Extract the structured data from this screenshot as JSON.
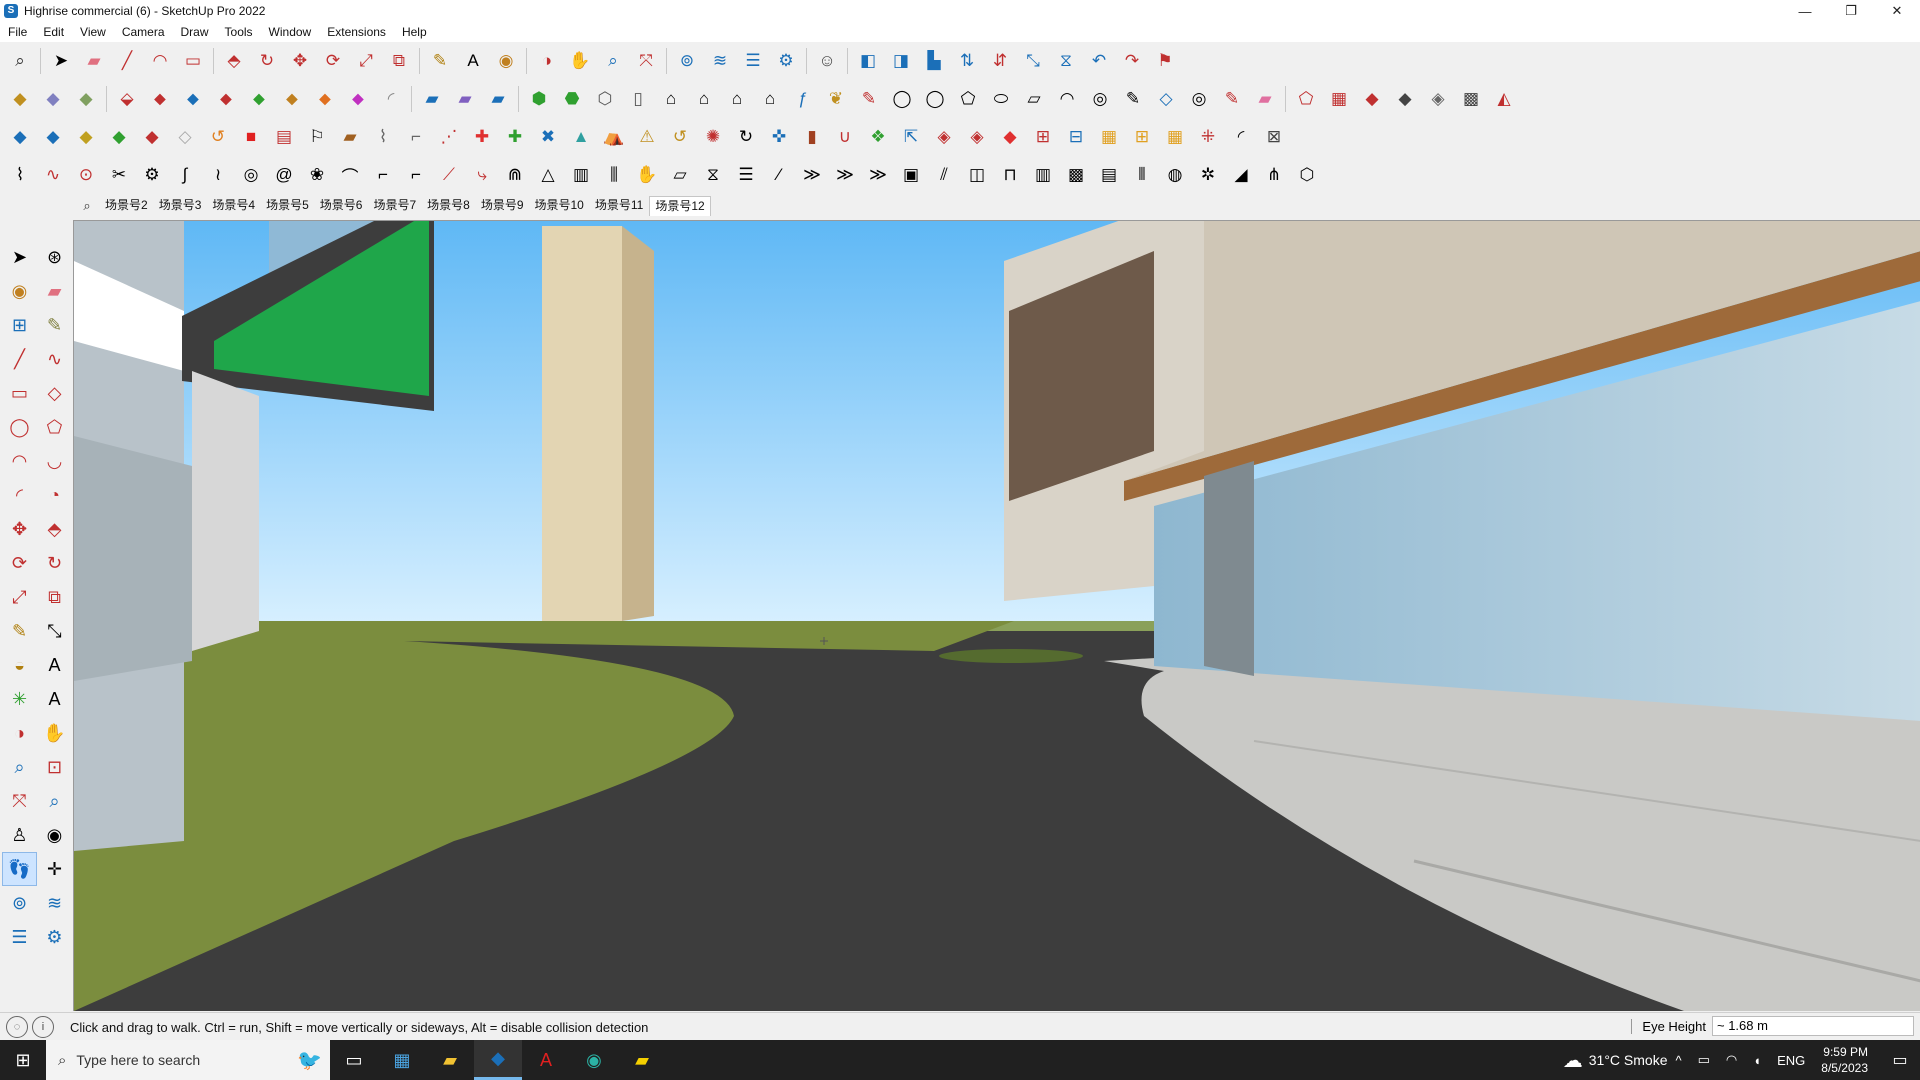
{
  "window": {
    "title": "Highrise commercial (6) - SketchUp Pro 2022",
    "minimize": "—",
    "restore": "❐",
    "close": "✕"
  },
  "menu": [
    "File",
    "Edit",
    "View",
    "Camera",
    "Draw",
    "Tools",
    "Window",
    "Extensions",
    "Help"
  ],
  "scenes": {
    "search_icon": "⌕",
    "tabs": [
      "场景号2",
      "场景号3",
      "场景号4",
      "场景号5",
      "场景号6",
      "场景号7",
      "场景号8",
      "场景号9",
      "场景号10",
      "场景号11",
      "场景号12"
    ],
    "active": "场景号12"
  },
  "status": {
    "message": "Click and drag to walk.  Ctrl = run, Shift = move vertically or sideways, Alt = disable collision detection",
    "vcb_label": "Eye Height",
    "vcb_value": "~ 1.68 m"
  },
  "taskbar": {
    "search_placeholder": "Type here to search",
    "weather": "31°C  Smoke",
    "language": "ENG",
    "time": "9:59 PM",
    "date": "8/5/2023"
  },
  "colors": {
    "sky_top": "#5fb8f5",
    "sky_bottom": "#d6efff",
    "road": "#3d3d3d",
    "grass": "#7b8d3e",
    "paving": "#c9c9c6",
    "taskbar": "#202020"
  }
}
